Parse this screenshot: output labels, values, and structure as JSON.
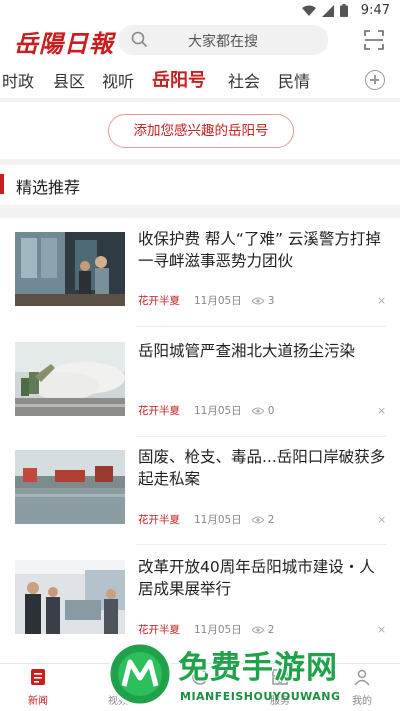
{
  "status_bar": {
    "time": "9:47"
  },
  "header": {
    "logo": "岳陽日報",
    "search_placeholder": "大家都在搜"
  },
  "tabs": [
    {
      "label": "时政"
    },
    {
      "label": "县区"
    },
    {
      "label": "视听"
    },
    {
      "label": "岳阳号",
      "active": true
    },
    {
      "label": "社会"
    },
    {
      "label": "民情"
    }
  ],
  "subscribe": {
    "label": "添加您感兴趣的岳阳号"
  },
  "section": {
    "title": "精选推荐"
  },
  "feed": [
    {
      "title": "收保护费 帮人“了难” 云溪警方打掉一寻衅滋事恶势力团伙",
      "source": "花开半夏",
      "date": "11月05日",
      "views": "3"
    },
    {
      "title": "岳阳城管严查湘北大道扬尘污染",
      "source": "花开半夏",
      "date": "11月05日",
      "views": "0"
    },
    {
      "title": "固废、枪支、毒品...岳阳口岸破获多起走私案",
      "source": "花开半夏",
      "date": "11月05日",
      "views": "2"
    },
    {
      "title": "改革开放40周年岳阳城市建设・人居成果展举行",
      "source": "花开半夏",
      "date": "11月05日",
      "views": "2"
    }
  ],
  "bottom_nav": [
    {
      "label": "新闻",
      "active": true
    },
    {
      "label": "视频"
    },
    {
      "label": ""
    },
    {
      "label": "服务"
    },
    {
      "label": "我的"
    }
  ],
  "watermark": {
    "title": "免费手游网",
    "subtitle": "MIANFEISHOUYOUWANG"
  },
  "colors": {
    "brand": "#c81e1e",
    "watermark": "#1fa24a"
  }
}
